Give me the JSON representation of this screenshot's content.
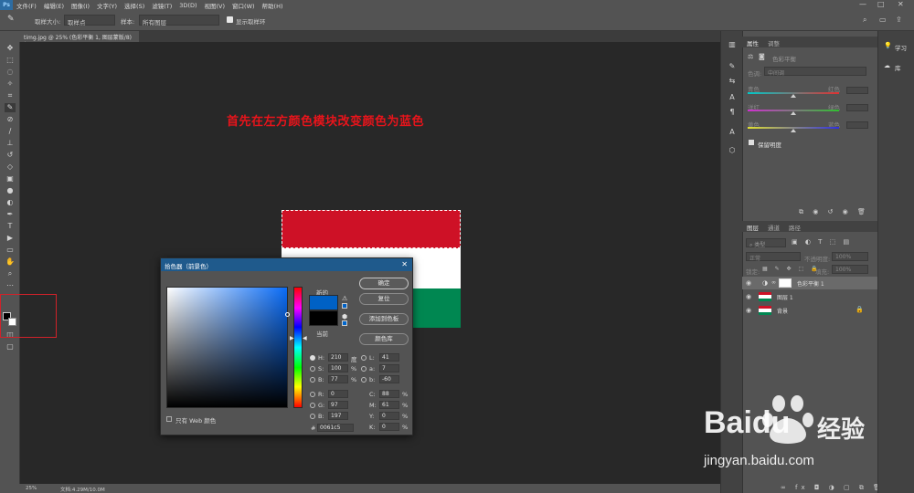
{
  "menubar": {
    "logo": "Ps",
    "items": [
      "文件(F)",
      "编辑(E)",
      "图像(I)",
      "文字(Y)",
      "选择(S)",
      "滤镜(T)",
      "3D(D)",
      "视图(V)",
      "窗口(W)",
      "帮助(H)"
    ],
    "window_controls": [
      "—",
      "□",
      "✕"
    ]
  },
  "options": {
    "sample_size_label": "取样大小:",
    "sample_size_value": "取样点",
    "sample_label": "样本:",
    "sample_value": "所有图层",
    "show_ring_label": "显示取样环"
  },
  "document": {
    "tab_title": "timg.jpg @ 25% (色彩平衡 1, 图层蒙版/8) *",
    "tab_close": "✕",
    "headline": "首先在左方颜色模块改变颜色为蓝色"
  },
  "status": {
    "zoom": "25%",
    "doc_info": "文档:4.29M/10.0M"
  },
  "flag": {
    "colors": [
      "#ce1126",
      "#ffffff",
      "#008751"
    ]
  },
  "color_picker": {
    "title": "拾色器（前景色）",
    "close": "✕",
    "new_label": "新的",
    "current_label": "当前",
    "new_color": "#0061c5",
    "current_color": "#000000",
    "buttons": {
      "ok": "确定",
      "reset": "复位",
      "add_swatch": "添加到色板",
      "libraries": "颜色库"
    },
    "web_only_label": "只有 Web 颜色",
    "hsb": {
      "h_label": "H:",
      "h": "210",
      "h_unit": "度",
      "s_label": "S:",
      "s": "100",
      "s_unit": "%",
      "b_label": "B:",
      "b": "77",
      "b_unit": "%"
    },
    "rgb": {
      "r_label": "R:",
      "r": "0",
      "g_label": "G:",
      "g": "97",
      "b_label": "B:",
      "b": "197"
    },
    "lab": {
      "l_label": "L:",
      "l": "41",
      "a_label": "a:",
      "a": "7",
      "b_label": "b:",
      "b": "-60"
    },
    "cmyk": {
      "c_label": "C:",
      "c": "88",
      "m_label": "M:",
      "m": "61",
      "y_label": "Y:",
      "y": "0",
      "k_label": "K:",
      "k": "0",
      "unit": "%"
    },
    "hex_label": "#",
    "hex": "0061c5"
  },
  "properties_panel": {
    "tab_properties": "属性",
    "tab_adjustments": "调整",
    "adjustment_name": "色彩平衡",
    "tone_label": "色调:",
    "tone_value": "中间调",
    "sliders": [
      {
        "left": "青色",
        "right": "红色",
        "colors": [
          "#00c8c8",
          "#e03030"
        ]
      },
      {
        "left": "洋红",
        "right": "绿色",
        "colors": [
          "#d030d0",
          "#30c030"
        ]
      },
      {
        "left": "黄色",
        "right": "蓝色",
        "colors": [
          "#e0e030",
          "#3030e0"
        ]
      }
    ],
    "preserve_luminosity": "保留明度"
  },
  "layers_panel": {
    "tab_layers": "图层",
    "tab_channels": "通道",
    "tab_paths": "路径",
    "search_placeholder": "类型",
    "blend_mode": "正常",
    "opacity_label": "不透明度:",
    "opacity_value": "100%",
    "lock_label": "锁定:",
    "fill_label": "填充:",
    "fill_value": "100%",
    "layers": [
      {
        "name": "色彩平衡 1",
        "kind": "adjustment"
      },
      {
        "name": "图层 1",
        "kind": "flag"
      },
      {
        "name": "背景",
        "kind": "flag"
      }
    ]
  },
  "right_dock": {
    "learn": "学习",
    "libraries": "库"
  },
  "watermark": {
    "brand": "Baidu",
    "brand_cn": "经验",
    "url": "jingyan.baidu.com"
  }
}
